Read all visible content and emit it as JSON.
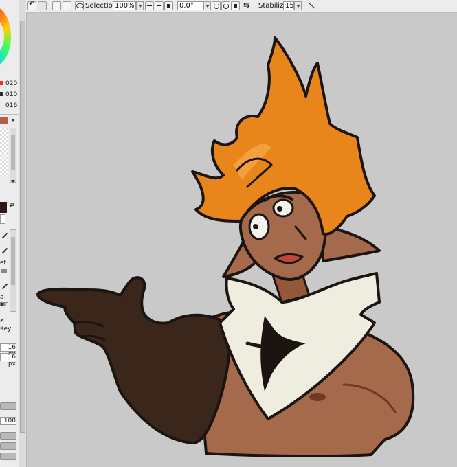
{
  "toolbar": {
    "selection_label": "Selection",
    "zoom_value": "100%",
    "zoom_minus_icon": "minus-icon",
    "zoom_plus_icon": "plus-icon",
    "rotation_value": "0.0°",
    "stabilizer_label": "Stabilizer",
    "stabilizer_value": "15"
  },
  "left_panel": {
    "swatch_values": [
      "020",
      "010",
      "016"
    ],
    "labels_partial": [
      "x",
      "Key"
    ],
    "size_fields": [
      "16 px",
      "16 px"
    ],
    "density_value": "100",
    "misc_label_fragments": [
      "et",
      "a-"
    ]
  },
  "colors": {
    "canvas_bg": "#c9c9c9",
    "skin": "#a0674a",
    "glove": "#3b261b",
    "hair": "#e8861c",
    "bandana": "#efece0",
    "outline": "#1c1411"
  }
}
